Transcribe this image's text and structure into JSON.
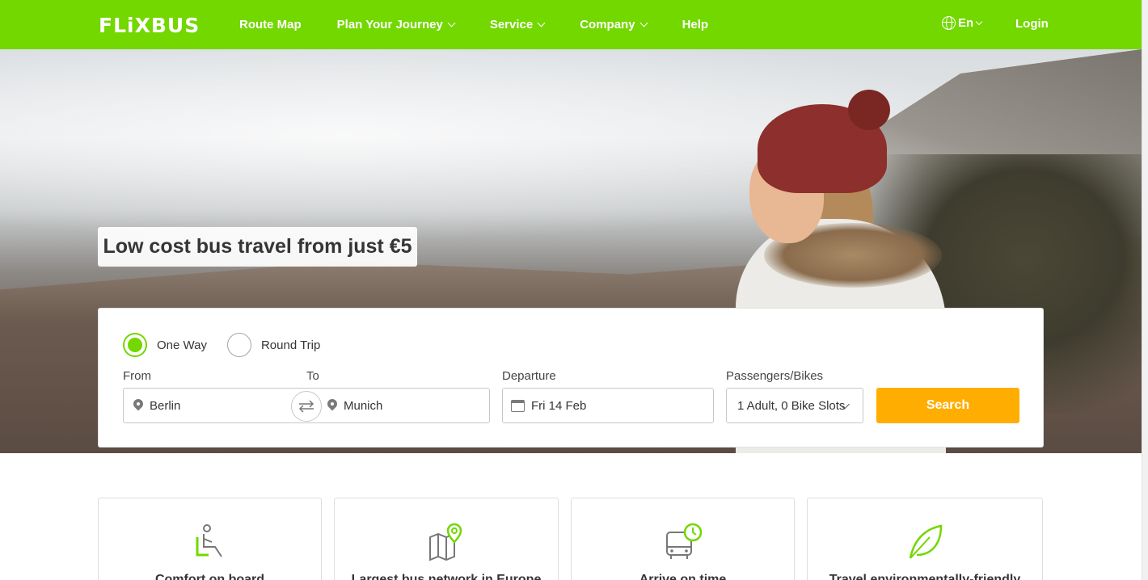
{
  "header": {
    "logo": "FLiXBUS",
    "nav": [
      {
        "label": "Route Map",
        "dropdown": false
      },
      {
        "label": "Plan Your Journey",
        "dropdown": true
      },
      {
        "label": "Service",
        "dropdown": true
      },
      {
        "label": "Company",
        "dropdown": true
      },
      {
        "label": "Help",
        "dropdown": false
      }
    ],
    "language": "En",
    "login": "Login"
  },
  "hero": {
    "headline": "Low cost bus travel from just €5"
  },
  "search": {
    "trip_types": [
      "One Way",
      "Round Trip"
    ],
    "selected_trip_type": "One Way",
    "from_label": "From",
    "from_value": "Berlin",
    "to_label": "To",
    "to_value": "Munich",
    "departure_label": "Departure",
    "departure_value": "Fri 14 Feb",
    "passengers_label": "Passengers/Bikes",
    "passengers_value": "1 Adult, 0 Bike Slots",
    "search_button": "Search"
  },
  "features": [
    {
      "title": "Comfort on board",
      "icon": "seat-icon"
    },
    {
      "title": "Largest bus network in Europe",
      "icon": "map-pin-icon"
    },
    {
      "title": "Arrive on time",
      "icon": "bus-clock-icon"
    },
    {
      "title": "Travel environmentally-friendly",
      "icon": "leaf-icon"
    }
  ],
  "colors": {
    "brand": "#73d700",
    "cta": "#ffad00",
    "text": "#353535"
  }
}
